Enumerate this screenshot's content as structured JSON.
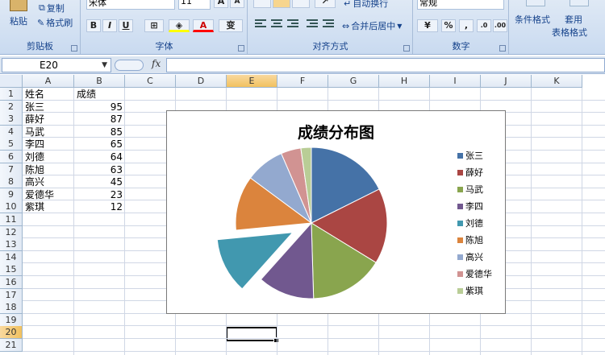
{
  "ribbon": {
    "clipboard": {
      "paste": "粘贴",
      "copy": "复制",
      "format_painter": "格式刷",
      "label": "剪贴板"
    },
    "font": {
      "name": "宋体",
      "size": "11",
      "label": "字体",
      "bold": "B",
      "italic": "I",
      "underline": "U",
      "grow": "A",
      "shrink": "A",
      "phonetic": "变"
    },
    "alignment": {
      "wrap_text": "自动换行",
      "merge_center": "合并后居中",
      "label": "对齐方式"
    },
    "number": {
      "format": "常规",
      "percent": "%",
      "comma": ",",
      "label": "数字"
    },
    "styles": {
      "conditional": "条件格式",
      "apply_table": "套用",
      "table_format": "表格格式"
    }
  },
  "formula_bar": {
    "name_box": "E20",
    "fx": "fx",
    "formula": ""
  },
  "columns": [
    "A",
    "B",
    "C",
    "D",
    "E",
    "F",
    "G",
    "H",
    "I",
    "J",
    "K"
  ],
  "rows": [
    "1",
    "2",
    "3",
    "4",
    "5",
    "6",
    "7",
    "8",
    "9",
    "10",
    "11",
    "12",
    "13",
    "14",
    "15",
    "16",
    "17",
    "18",
    "19",
    "20",
    "21"
  ],
  "selected_column": "E",
  "selected_row": "20",
  "sheet": {
    "header": [
      "姓名",
      "成绩"
    ],
    "records": [
      {
        "name": "张三",
        "score": "95"
      },
      {
        "name": "薛好",
        "score": "87"
      },
      {
        "name": "马武",
        "score": "85"
      },
      {
        "name": "李四",
        "score": "65"
      },
      {
        "name": "刘德",
        "score": "64"
      },
      {
        "name": "陈旭",
        "score": "63"
      },
      {
        "name": "高兴",
        "score": "45"
      },
      {
        "name": "爱德华",
        "score": "23"
      },
      {
        "name": "紫琪",
        "score": "12"
      }
    ]
  },
  "chart_data": {
    "type": "pie",
    "title": "成绩分布图",
    "categories": [
      "张三",
      "薛好",
      "马武",
      "李四",
      "刘德",
      "陈旭",
      "高兴",
      "爱德华",
      "紫琪"
    ],
    "values": [
      95,
      87,
      85,
      65,
      64,
      63,
      45,
      23,
      12
    ],
    "colors": [
      "#4572a7",
      "#aa4643",
      "#89a54e",
      "#71588f",
      "#4198af",
      "#db843d",
      "#93a9cf",
      "#d19392",
      "#b9cd96"
    ],
    "exploded": [
      "刘德"
    ],
    "legend": "right",
    "start_angle": "12 o'clock",
    "direction": "clockwise"
  }
}
